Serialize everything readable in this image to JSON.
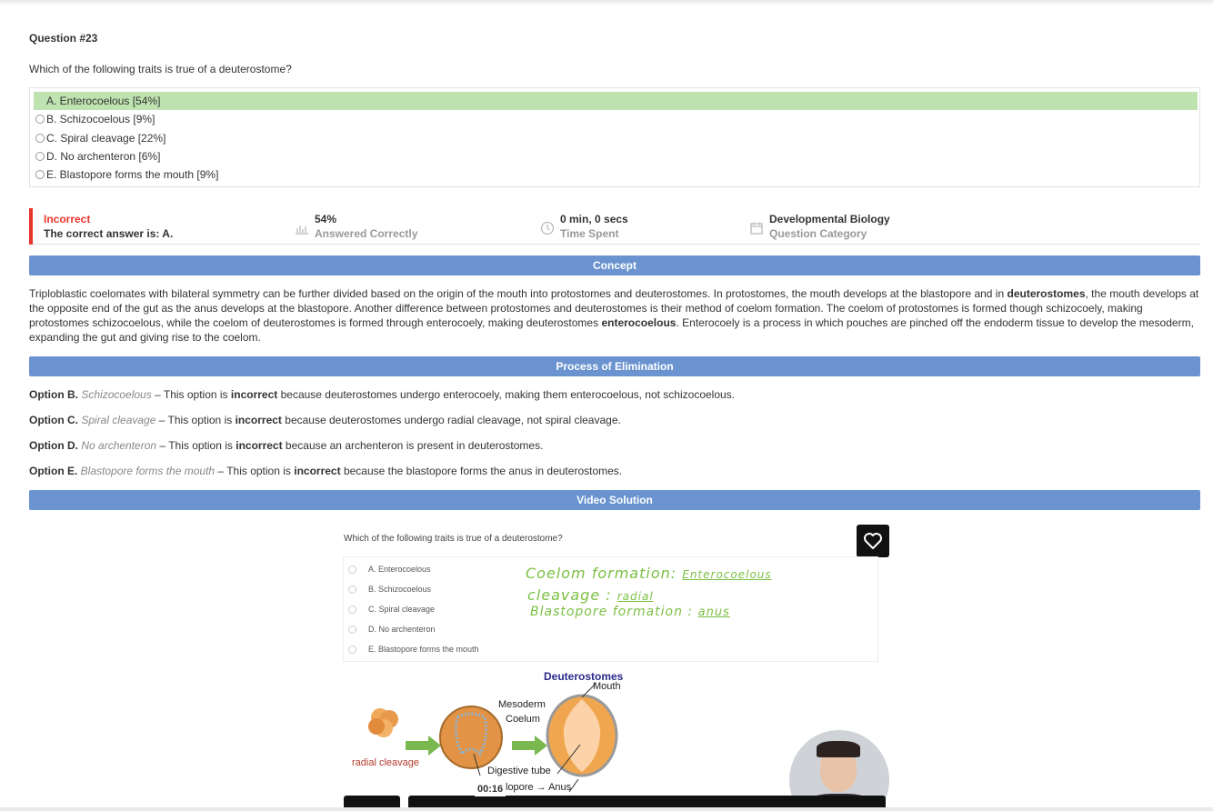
{
  "question": {
    "number_label": "Question #23",
    "text": "Which of the following traits is true of a deuterostome?",
    "choices": [
      {
        "label": "A. Enterocoelous [54%]",
        "correct": true
      },
      {
        "label": "B. Schizocoelous [9%]",
        "correct": false
      },
      {
        "label": "C. Spiral cleavage [22%]",
        "correct": false
      },
      {
        "label": "D. No archenteron [6%]",
        "correct": false
      },
      {
        "label": "E. Blastopore forms the mouth [9%]",
        "correct": false
      }
    ]
  },
  "result": {
    "status": "Incorrect",
    "correct_answer": "The correct answer is: A.",
    "percent": "54%",
    "percent_label": "Answered Correctly",
    "time": "0 min, 0 secs",
    "time_label": "Time Spent",
    "category": "Developmental Biology",
    "category_label": "Question Category",
    "status_color": "#e8352b"
  },
  "sections": {
    "concept": "Concept",
    "elimination": "Process of Elimination",
    "video": "Video Solution"
  },
  "concept": {
    "p1": "Triploblastic coelomates with bilateral symmetry can be further divided based on the origin of the mouth into protostomes and deuterostomes. In protostomes, the mouth develops at the blastopore and in ",
    "b1": "deuterostomes",
    "p2": ", the mouth develops at the opposite end of the gut as the anus develops at the blastopore. Another difference between protostomes and deuterostomes is their method of coelom formation. The coelom of protostomes is formed though schizocoely, making protostomes schizocoelous, while the coelom of deuterostomes is formed through enterocoely, making deuterostomes ",
    "b2": "enterocoelous",
    "p3": ". Enterocoely is a process in which pouches are pinched off the endoderm tissue to develop the mesoderm, expanding the gut and giving rise to the coelom."
  },
  "elimination": [
    {
      "option": "Option B.",
      "name": "Schizocoelous",
      "pre": " – This option is ",
      "bold": "incorrect",
      "post": " because deuterostomes undergo enterocoely, making them enterocoelous, not schizocoelous."
    },
    {
      "option": "Option C.",
      "name": "Spiral cleavage",
      "pre": " – This option is ",
      "bold": "incorrect",
      "post": " because deuterostomes undergo radial cleavage, not spiral cleavage."
    },
    {
      "option": "Option D.",
      "name": "No archenteron",
      "pre": " – This option is ",
      "bold": "incorrect",
      "post": " because an archenteron is present in deuterostomes."
    },
    {
      "option": "Option E.",
      "name": "Blastopore forms the mouth",
      "pre": " – This option is ",
      "bold": "incorrect",
      "post": " because the blastopore forms the anus in deuterostomes."
    }
  ],
  "video": {
    "question": "Which of the following traits is true of a deuterostome?",
    "options": [
      "A. Enterocoelous",
      "B. Schizocoelous",
      "C. Spiral cleavage",
      "D. No archenteron",
      "E. Blastopore forms the mouth"
    ],
    "handwriting": {
      "line1_a": "Coelom formation: ",
      "line1_b": "Enterocoelous",
      "line2_a": "cleavage : ",
      "line2_b": "radial",
      "line3_a": "Blastopore formation : ",
      "line3_b": "anus"
    },
    "diagram": {
      "title": "Deuterostomes",
      "mouth": "Mouth",
      "mesoderm": "Mesoderm",
      "coelum": "Coelum",
      "digestive": "Digestive tube",
      "blastopore": "lopore",
      "anus": "Anus",
      "radial": "radial cleavage"
    },
    "timestamp": "00:16"
  }
}
